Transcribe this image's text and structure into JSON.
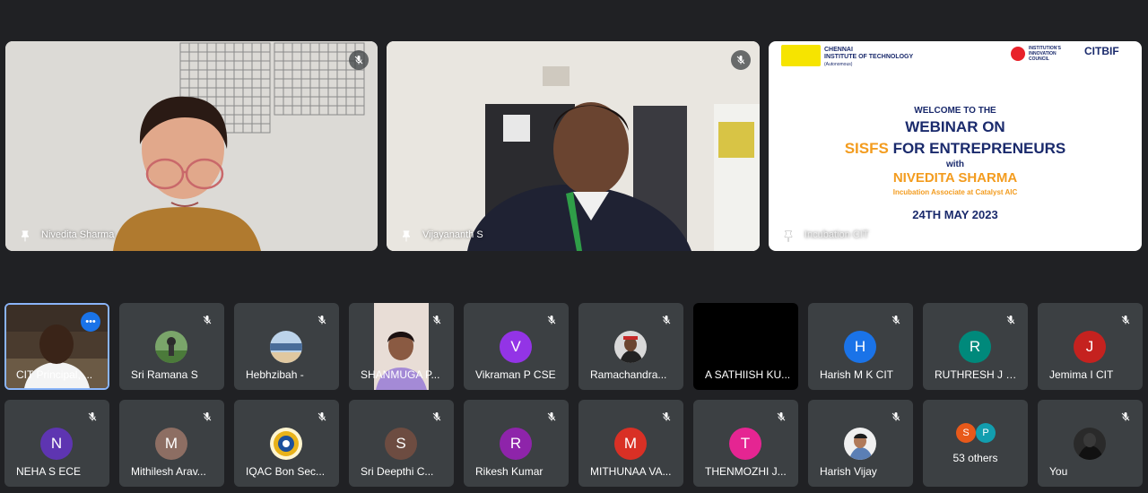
{
  "pinned": [
    {
      "name": "Nivedita Sharma"
    },
    {
      "name": "Vijayananth S"
    },
    {
      "name": "Incubation CIT"
    }
  ],
  "slide": {
    "org_line1": "CHENNAI",
    "org_line2": "INSTITUTE OF TECHNOLOGY",
    "org_line3": "(Autonomous)",
    "iic_label": "INSTITUTION'S INNOVATION COUNCIL",
    "citbif": "CITBIF",
    "welcome": "WELCOME TO THE",
    "line1": "WEBINAR ON",
    "line2_a": "SISFS",
    "line2_b": "FOR ENTREPRENEURS",
    "with": "with",
    "speaker": "NIVEDITA SHARMA",
    "speaker_role": "Incubation Associate at Catalyst AIC",
    "date": "24TH MAY 2023"
  },
  "row1": [
    {
      "name": "CIT Principal, ...",
      "kind": "photo"
    },
    {
      "name": "Sri Ramana S",
      "kind": "photo"
    },
    {
      "name": "Hebhzibah -",
      "kind": "photo"
    },
    {
      "name": "SHANMUGA P...",
      "kind": "video"
    },
    {
      "name": "Vikraman P CSE",
      "initial": "V",
      "color": "#9334e6"
    },
    {
      "name": "Ramachandra...",
      "kind": "photo"
    },
    {
      "name": "A SATHIISH KU...",
      "kind": "black"
    },
    {
      "name": "Harish M K CIT",
      "initial": "H",
      "color": "#1a73e8"
    },
    {
      "name": "RUTHRESH J C...",
      "initial": "R",
      "color": "#00897b"
    },
    {
      "name": "Jemima I CIT",
      "initial": "J",
      "color": "#c5221f"
    }
  ],
  "row2": [
    {
      "name": "NEHA S ECE",
      "initial": "N",
      "color": "#5e35b1"
    },
    {
      "name": "Mithilesh Arav...",
      "initial": "M",
      "color": "#8d6e63"
    },
    {
      "name": "IQAC Bon Sec...",
      "kind": "photo"
    },
    {
      "name": "Sri Deepthi C...",
      "initial": "S",
      "color": "#6d4c41"
    },
    {
      "name": "Rikesh Kumar",
      "initial": "R",
      "color": "#8e24aa"
    },
    {
      "name": "MITHUNAA VA...",
      "initial": "M",
      "color": "#d93025"
    },
    {
      "name": "THENMOZHI J...",
      "initial": "T",
      "color": "#e52592"
    },
    {
      "name": "Harish Vijay",
      "kind": "photo"
    },
    {
      "name": "53 others",
      "kind": "others",
      "others_initials": [
        "S",
        "P"
      ]
    },
    {
      "name": "You",
      "kind": "photo"
    }
  ],
  "colors": {
    "background": "#202124",
    "tile": "#3c4043",
    "active_border": "#8ab4f8"
  }
}
